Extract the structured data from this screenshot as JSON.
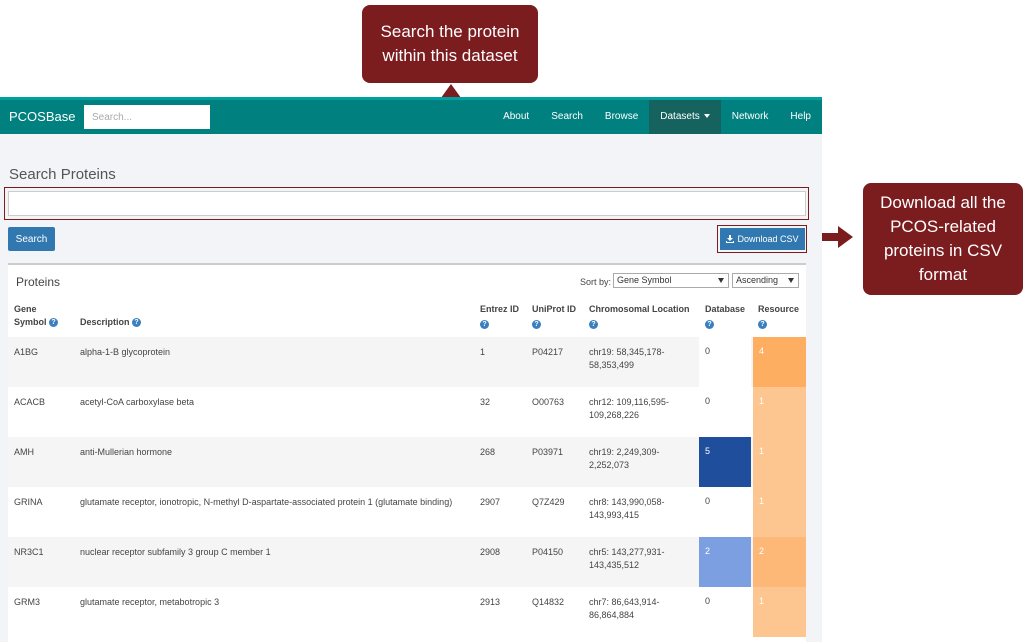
{
  "callouts": {
    "search_note": "Search the protein within this dataset",
    "download_note": "Download all the PCOS-related proteins in CSV format"
  },
  "navbar": {
    "brand": "PCOSBase",
    "search_placeholder": "Search...",
    "items": [
      "About",
      "Search",
      "Browse",
      "Datasets",
      "Network",
      "Help"
    ],
    "active": "Datasets"
  },
  "page": {
    "title": "Search Proteins",
    "search_button": "Search",
    "download_button": "Download CSV"
  },
  "panel": {
    "title": "Proteins",
    "sort_label": "Sort by:",
    "sort_field": "Gene Symbol",
    "sort_order": "Ascending"
  },
  "table": {
    "headers": {
      "gene": [
        "Gene",
        "Symbol"
      ],
      "description": "Description",
      "entrez": "Entrez ID",
      "uniprot": "UniProt ID",
      "chromosome": "Chromosomal Location",
      "database": "Database",
      "resource": "Resource"
    },
    "help_icon_glyph": "?",
    "rows": [
      {
        "gene": "A1BG",
        "description": "alpha-1-B glycoprotein",
        "entrez": "1",
        "uniprot": "P04217",
        "loc1": "chr19: 58,345,178-",
        "loc2": "58,353,499",
        "database": "0",
        "resource": "4",
        "db_color": "#ffffff",
        "res_color": "#fdae61"
      },
      {
        "gene": "ACACB",
        "description": "acetyl-CoA carboxylase beta",
        "entrez": "32",
        "uniprot": "O00763",
        "loc1": "chr12: 109,116,595-",
        "loc2": "109,268,226",
        "database": "0",
        "resource": "1",
        "db_color": "#ffffff",
        "res_color": "#fdc590"
      },
      {
        "gene": "AMH",
        "description": "anti-Mullerian hormone",
        "entrez": "268",
        "uniprot": "P03971",
        "loc1": "chr19: 2,249,309-",
        "loc2": "2,252,073",
        "database": "5",
        "resource": "1",
        "db_color": "#1f4e9c",
        "res_color": "#fdc590"
      },
      {
        "gene": "GRINA",
        "description": "glutamate receptor, ionotropic, N-methyl D-aspartate-associated protein 1 (glutamate binding)",
        "entrez": "2907",
        "uniprot": "Q7Z429",
        "loc1": "chr8: 143,990,058-",
        "loc2": "143,993,415",
        "database": "0",
        "resource": "1",
        "db_color": "#ffffff",
        "res_color": "#fdc590"
      },
      {
        "gene": "NR3C1",
        "description": "nuclear receptor subfamily 3 group C member 1",
        "entrez": "2908",
        "uniprot": "P04150",
        "loc1": "chr5: 143,277,931-",
        "loc2": "143,435,512",
        "database": "2",
        "resource": "2",
        "db_color": "#7b9fe0",
        "res_color": "#fdb877"
      },
      {
        "gene": "GRM3",
        "description": "glutamate receptor, metabotropic 3",
        "entrez": "2913",
        "uniprot": "Q14832",
        "loc1": "chr7: 86,643,914-",
        "loc2": "86,864,884",
        "database": "0",
        "resource": "1",
        "db_color": "#ffffff",
        "res_color": "#fdc590"
      }
    ]
  }
}
